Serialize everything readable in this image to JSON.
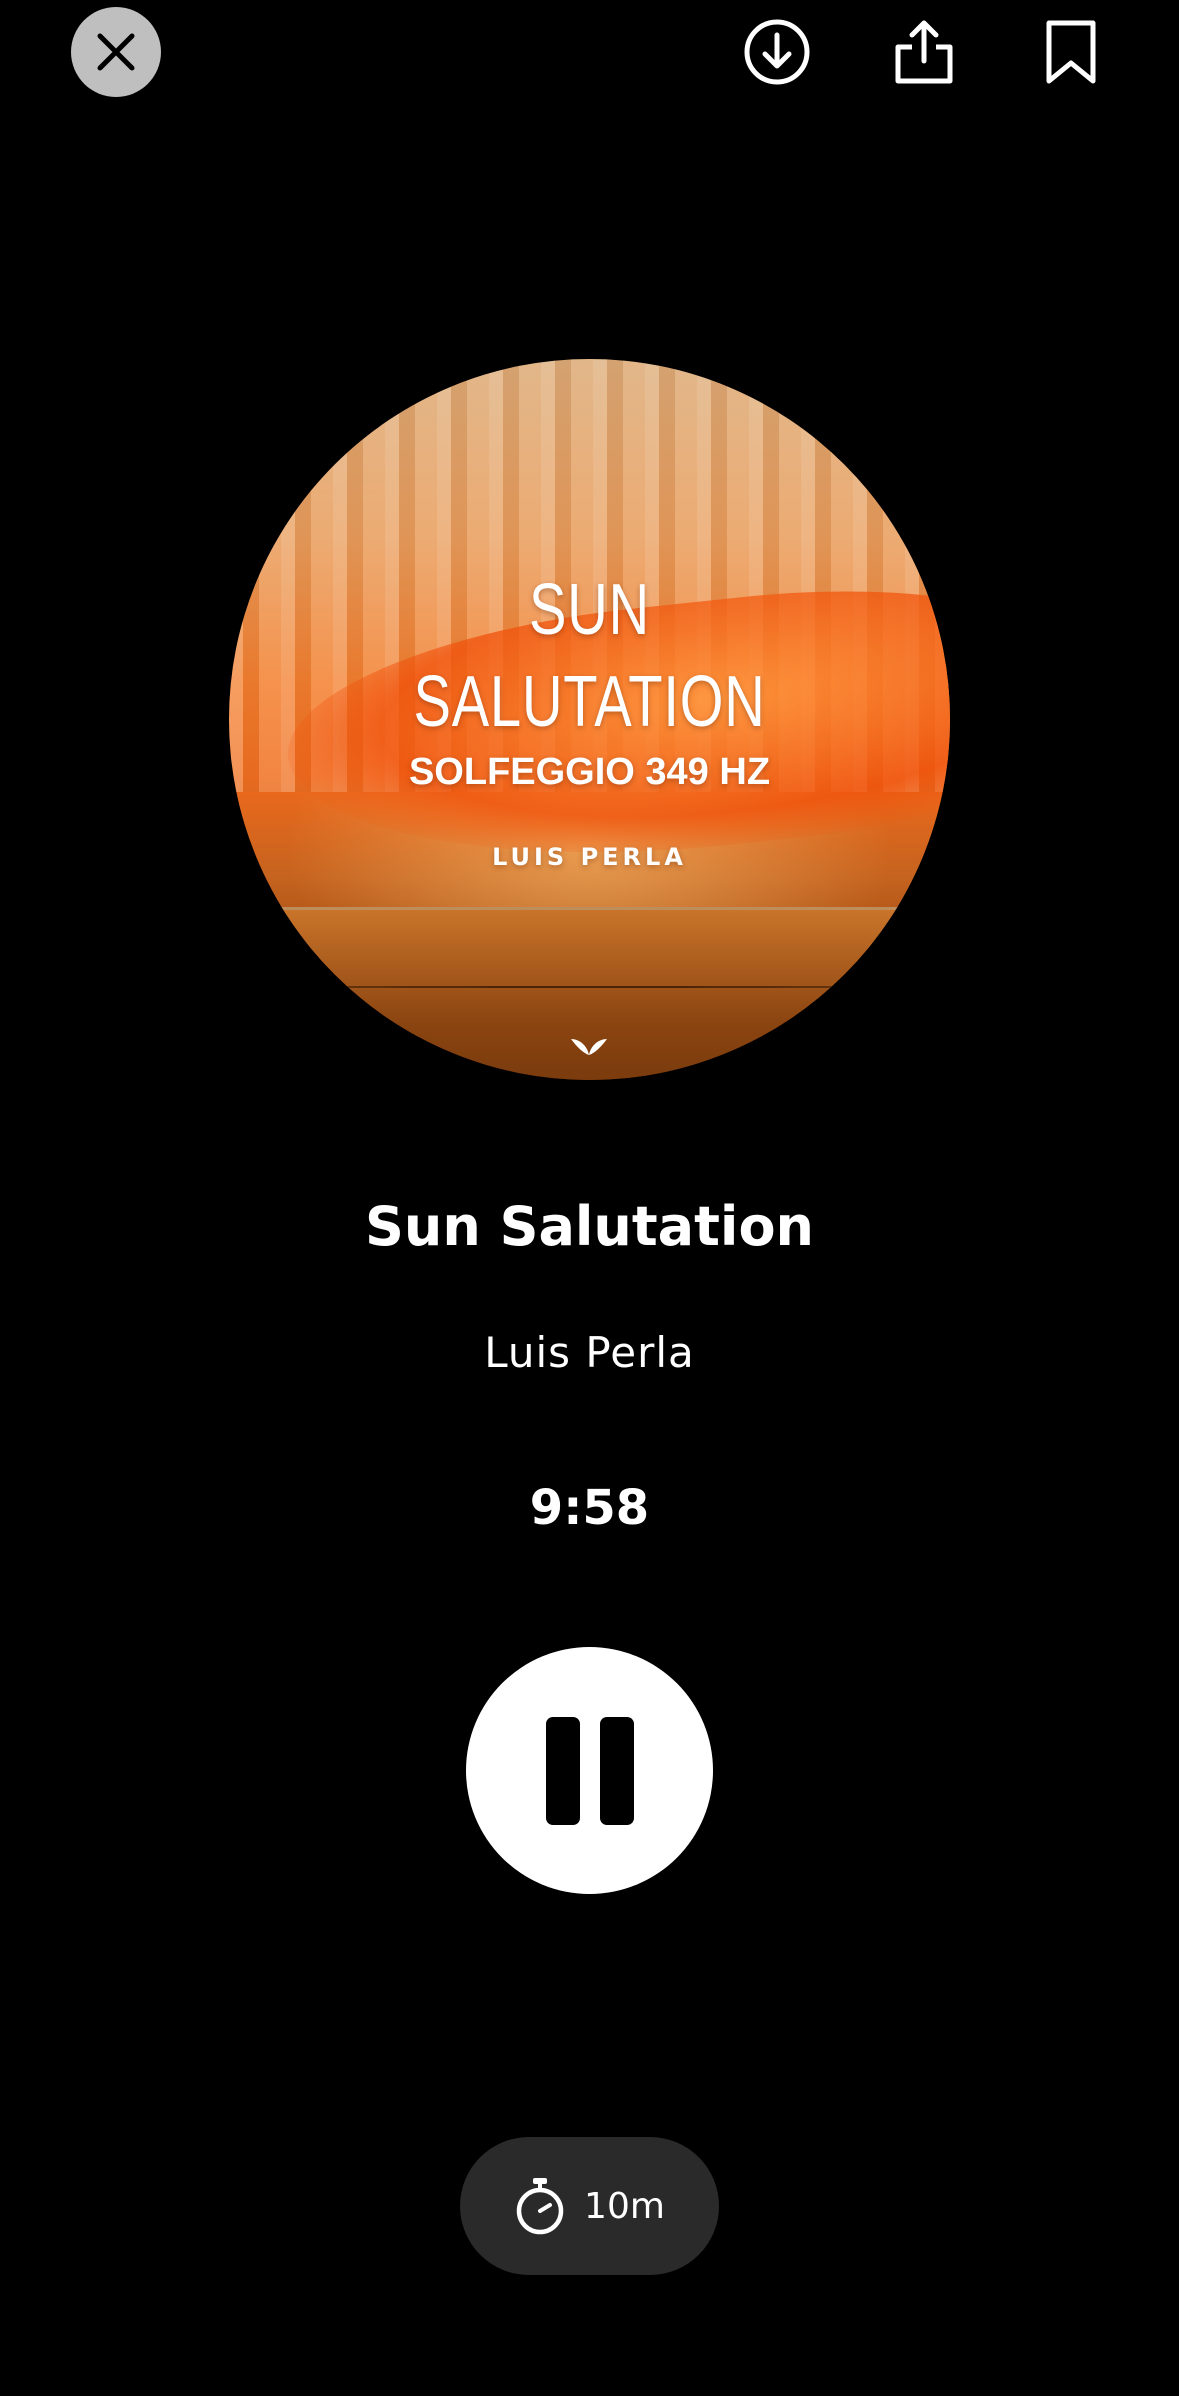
{
  "header": {
    "close_icon": "close-icon",
    "download_icon": "download-icon",
    "share_icon": "share-icon",
    "bookmark_icon": "bookmark-icon"
  },
  "artwork": {
    "title_line1": "SUN",
    "title_line2": "SALUTATION",
    "subtitle": "SOLFEGGIO 349 HZ",
    "artist": "LUIS PERLA",
    "logo_icon": "brand-logo-icon",
    "accent_color": "#f27a2a"
  },
  "track": {
    "title": "Sun Salutation",
    "artist": "Luis Perla",
    "remaining_time": "9:58"
  },
  "controls": {
    "pause_icon": "pause-icon"
  },
  "timer": {
    "icon": "stopwatch-icon",
    "label": "10m"
  }
}
